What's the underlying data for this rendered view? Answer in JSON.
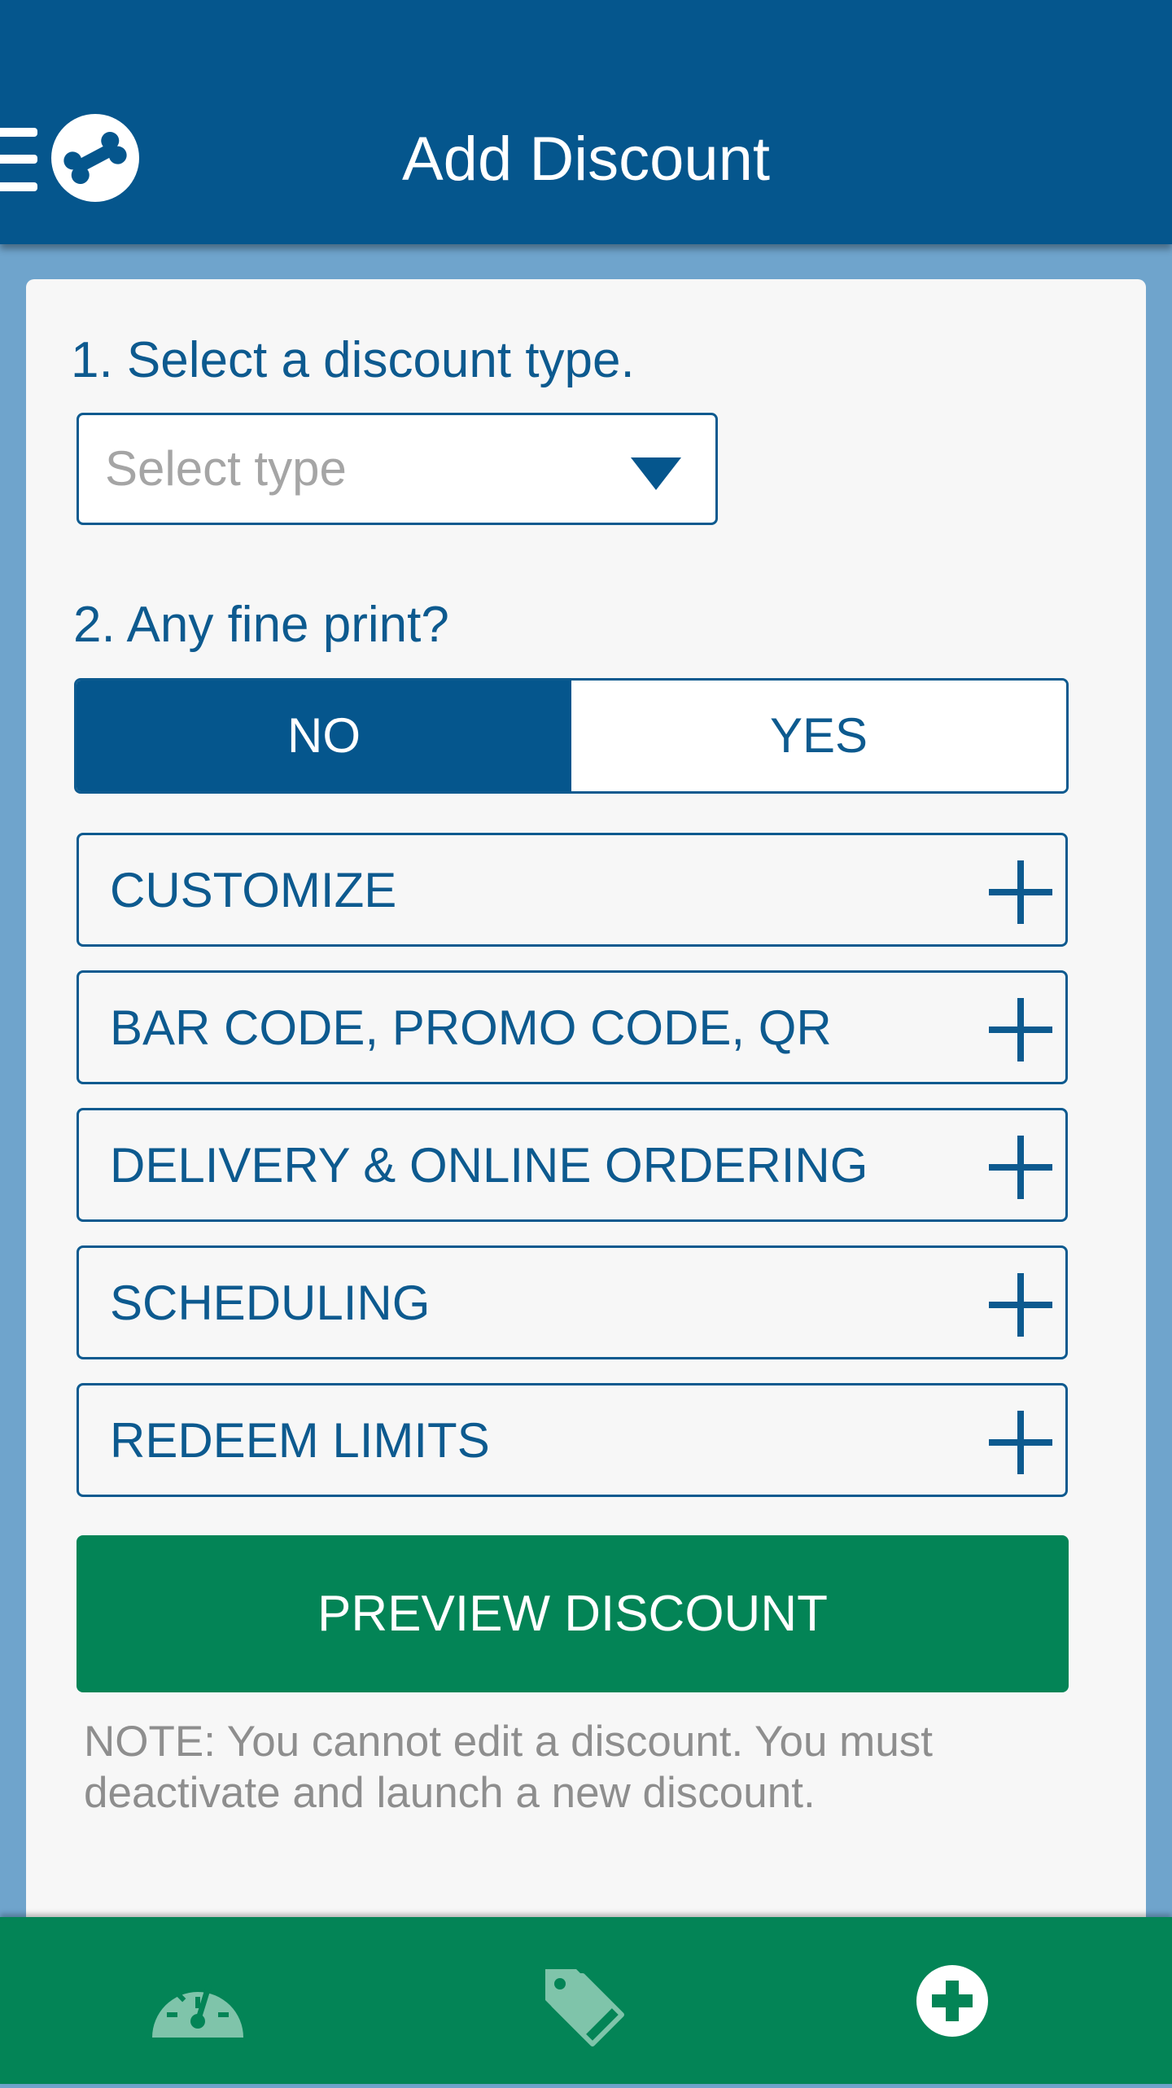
{
  "app_bar": {
    "title": "Add Discount",
    "menu_icon": "hamburger-menu-icon",
    "logo_icon": "bone-logo-icon"
  },
  "step1": {
    "label": "1. Select a discount type.",
    "select": {
      "placeholder": "Select type",
      "icon": "dropdown-caret-icon"
    }
  },
  "step2": {
    "label": "2. Any fine print?",
    "toggle": {
      "no_label": "NO",
      "yes_label": "YES",
      "selected": "NO"
    }
  },
  "sections": [
    {
      "label": "CUSTOMIZE"
    },
    {
      "label": "BAR CODE, PROMO CODE, QR"
    },
    {
      "label": "DELIVERY & ONLINE ORDERING"
    },
    {
      "label": "SCHEDULING"
    },
    {
      "label": "REDEEM LIMITS"
    }
  ],
  "preview_button": {
    "label": "PREVIEW DISCOUNT"
  },
  "note": "NOTE: You cannot edit a discount. You must deactivate and launch a new discount.",
  "bottom_nav": {
    "items": [
      {
        "icon": "dashboard-gauge-icon",
        "active": false
      },
      {
        "icon": "tags-icon",
        "active": false
      },
      {
        "icon": "add-circle-icon",
        "active": true
      }
    ]
  },
  "colors": {
    "primary_blue": "#05568d",
    "background_blue": "#6fa4cc",
    "accent_green": "#038456",
    "card_background": "#f7f7f7",
    "text_blue": "#0d5a8f",
    "placeholder_gray": "#a5a5a5",
    "note_gray": "#8e8e8e"
  }
}
